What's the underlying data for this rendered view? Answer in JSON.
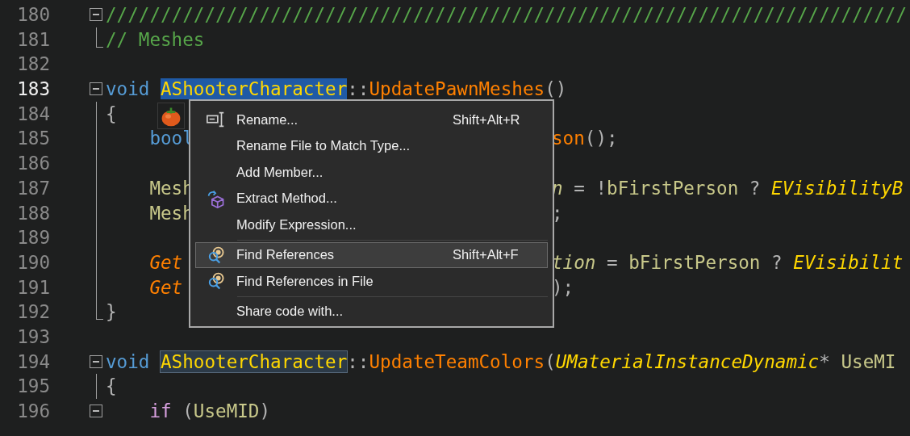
{
  "editor": {
    "lines": [
      {
        "number": "180",
        "current": false,
        "kind": "fold",
        "expanded": true,
        "tokens": [
          {
            "kind": "comment",
            "text": "/////////////////////////////////////////////////////////////////////////"
          }
        ]
      },
      {
        "number": "181",
        "current": false,
        "kind": "end",
        "tokens": [
          {
            "kind": "comment",
            "text": "// Meshes"
          }
        ]
      },
      {
        "number": "182",
        "current": false,
        "kind": "blank"
      },
      {
        "number": "183",
        "current": true,
        "kind": "fold",
        "expanded": true,
        "tokens": [
          {
            "kind": "keyword",
            "text": "void "
          },
          {
            "kind": "type_selected",
            "text": "AShooterCharacter"
          },
          {
            "kind": "punct",
            "text": "::"
          },
          {
            "kind": "function",
            "text": "UpdatePawnMeshes"
          },
          {
            "kind": "punct",
            "text": "()"
          }
        ]
      },
      {
        "number": "184",
        "current": false,
        "kind": "body",
        "tokens": [
          {
            "kind": "punct",
            "text": "{"
          }
        ]
      },
      {
        "number": "185",
        "current": false,
        "kind": "body",
        "tokens": [
          {
            "kind": "keyword",
            "text": "    bool"
          }
        ],
        "after_menu": [
          {
            "kind": "function",
            "text": "son"
          },
          {
            "kind": "punct",
            "text": "();"
          }
        ]
      },
      {
        "number": "186",
        "current": false,
        "kind": "body"
      },
      {
        "number": "187",
        "current": false,
        "kind": "body",
        "tokens": [
          {
            "kind": "variable",
            "text": "    Mesh"
          }
        ],
        "after_menu": [
          {
            "kind": "variable_italic",
            "text": "n"
          },
          {
            "kind": "punct",
            "text": " = !"
          },
          {
            "kind": "variable",
            "text": "bFirstPerson"
          },
          {
            "kind": "punct",
            "text": " ? "
          },
          {
            "kind": "type_italic",
            "text": "EVisibilityB"
          }
        ]
      },
      {
        "number": "188",
        "current": false,
        "kind": "body",
        "tokens": [
          {
            "kind": "variable",
            "text": "    Mesh"
          }
        ],
        "after_menu": [
          {
            "kind": "punct",
            "text": ";"
          }
        ]
      },
      {
        "number": "189",
        "current": false,
        "kind": "body"
      },
      {
        "number": "190",
        "current": false,
        "kind": "body",
        "tokens": [
          {
            "kind": "function_italic",
            "text": "    Get"
          }
        ],
        "after_menu": [
          {
            "kind": "variable_italic",
            "text": "tion"
          },
          {
            "kind": "punct",
            "text": " = "
          },
          {
            "kind": "variable",
            "text": "bFirstPerson"
          },
          {
            "kind": "punct",
            "text": " ? "
          },
          {
            "kind": "type_italic",
            "text": "EVisibilit"
          }
        ]
      },
      {
        "number": "191",
        "current": false,
        "kind": "body",
        "tokens": [
          {
            "kind": "function_italic",
            "text": "    Get"
          }
        ],
        "after_menu": [
          {
            "kind": "punct",
            "text": ");"
          }
        ]
      },
      {
        "number": "192",
        "current": false,
        "kind": "end",
        "tokens": [
          {
            "kind": "punct",
            "text": "}"
          }
        ]
      },
      {
        "number": "193",
        "current": false,
        "kind": "blank"
      },
      {
        "number": "194",
        "current": false,
        "kind": "fold",
        "expanded": true,
        "tokens": [
          {
            "kind": "keyword",
            "text": "void "
          },
          {
            "kind": "type_reference",
            "text": "AShooterCharacter"
          },
          {
            "kind": "punct",
            "text": "::"
          },
          {
            "kind": "function",
            "text": "UpdateTeamColors"
          },
          {
            "kind": "punct",
            "text": "("
          },
          {
            "kind": "type_italic",
            "text": "UMaterialInstanceDynamic"
          },
          {
            "kind": "punct",
            "text": "* "
          },
          {
            "kind": "variable",
            "text": "UseMI"
          }
        ]
      },
      {
        "number": "195",
        "current": false,
        "kind": "body",
        "tokens": [
          {
            "kind": "punct",
            "text": "{"
          }
        ]
      },
      {
        "number": "196",
        "current": false,
        "kind": "fold",
        "expanded": true,
        "tokens": [
          {
            "kind": "control",
            "text": "    if"
          },
          {
            "kind": "punct",
            "text": " ("
          },
          {
            "kind": "variable",
            "text": "UseMID"
          },
          {
            "kind": "punct",
            "text": ")"
          }
        ]
      }
    ]
  },
  "context_menu": {
    "items": [
      {
        "kind": "rename",
        "label": "Rename...",
        "shortcut": "Shift+Alt+R",
        "selected": false,
        "separator_before": false
      },
      {
        "kind": "plain",
        "label": "Rename File to Match Type...",
        "selected": false,
        "separator_before": false
      },
      {
        "kind": "plain",
        "label": "Add Member...",
        "selected": false,
        "separator_before": false
      },
      {
        "kind": "extract",
        "label": "Extract Method...",
        "selected": false,
        "separator_before": false
      },
      {
        "kind": "plain",
        "label": "Modify Expression...",
        "selected": false,
        "separator_before": false
      },
      {
        "kind": "find",
        "label": "Find References",
        "shortcut": "Shift+Alt+F",
        "selected": true,
        "separator_before": true
      },
      {
        "kind": "find",
        "label": "Find References in File",
        "selected": false,
        "separator_before": false
      },
      {
        "kind": "plain",
        "label": "Share code with...",
        "selected": false,
        "separator_before": true
      }
    ]
  }
}
